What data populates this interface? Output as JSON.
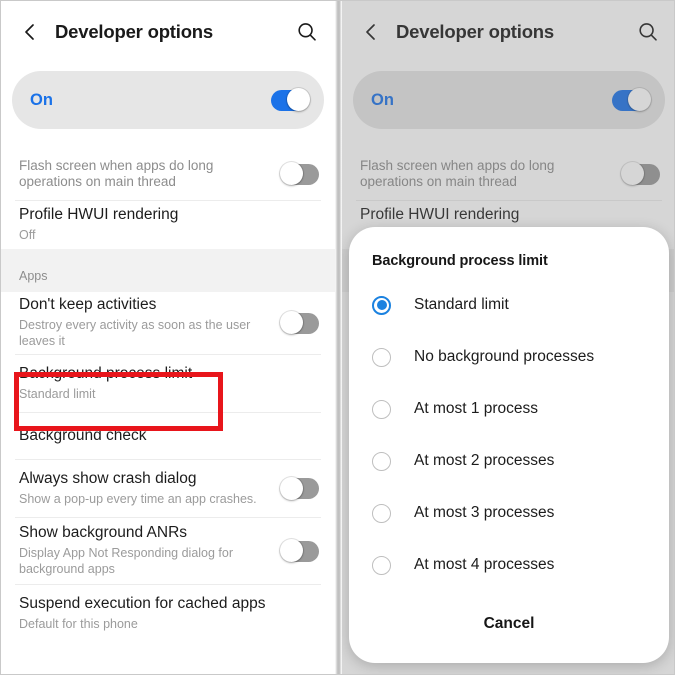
{
  "header": {
    "title": "Developer options",
    "back_icon": "chevron-left-icon",
    "search_icon": "search-icon"
  },
  "master_switch": {
    "label": "On",
    "state": "on",
    "accent_color": "#1b72e8"
  },
  "settings_list": [
    {
      "title": "Flash screen when apps do long operations on main thread",
      "subtitle": "",
      "style": "dim",
      "control": "toggle",
      "toggle_state": "off"
    },
    {
      "title": "Profile HWUI rendering",
      "subtitle": "Off",
      "style": "normal",
      "control": "none"
    }
  ],
  "section_header": "Apps",
  "apps_list": [
    {
      "title": "Don't keep activities",
      "subtitle": "Destroy every activity as soon as the user leaves it",
      "control": "toggle",
      "toggle_state": "off"
    },
    {
      "title": "Background process limit",
      "subtitle": "Standard limit",
      "control": "none",
      "highlighted": true
    },
    {
      "title": "Background check",
      "subtitle": "",
      "control": "none"
    },
    {
      "title": "Always show crash dialog",
      "subtitle": "Show a pop-up every time an app crashes.",
      "control": "toggle",
      "toggle_state": "off"
    },
    {
      "title": "Show background ANRs",
      "subtitle": "Display App Not Responding dialog for background apps",
      "control": "toggle",
      "toggle_state": "off"
    },
    {
      "title": "Suspend execution for cached apps",
      "subtitle": "Default for this phone",
      "control": "none"
    }
  ],
  "dialog": {
    "title": "Background process limit",
    "options": [
      {
        "label": "Standard limit",
        "selected": true
      },
      {
        "label": "No background processes",
        "selected": false
      },
      {
        "label": "At most 1 process",
        "selected": false
      },
      {
        "label": "At most 2 processes",
        "selected": false
      },
      {
        "label": "At most 3 processes",
        "selected": false
      },
      {
        "label": "At most 4 processes",
        "selected": false
      }
    ],
    "cancel_label": "Cancel",
    "selected_color": "#1b82e0"
  },
  "annotation": {
    "highlight_color": "#e8151b",
    "target": "Background process limit"
  }
}
